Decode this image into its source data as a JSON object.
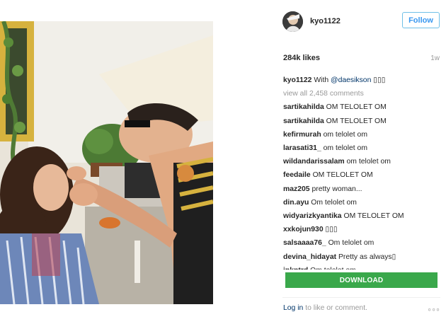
{
  "post": {
    "username": "kyo1122",
    "follow_label": "Follow",
    "likes": "284k likes",
    "time": "1w"
  },
  "caption": {
    "username": "kyo1122",
    "text_before": "With",
    "mention": "@daesikson",
    "text_after": "▯▯▯"
  },
  "view_all": "view all 2,458 comments",
  "comments": [
    {
      "user": "sartikahilda",
      "text": "OM TELOLET OM"
    },
    {
      "user": "sartikahilda",
      "text": "OM TELOLET OM"
    },
    {
      "user": "kefirmurah",
      "text": "om telolet om"
    },
    {
      "user": "larasati31_",
      "text": "om telolet om"
    },
    {
      "user": "wildandarissalam",
      "text": "om telolet om"
    },
    {
      "user": "feedaile",
      "text": "OM TELOLET OM"
    },
    {
      "user": "maz205",
      "text": "pretty woman..."
    },
    {
      "user": "din.ayu",
      "text": "Om telolet om"
    },
    {
      "user": "widyarizkyantika",
      "text": "OM TELOLET OM"
    },
    {
      "user": "xxkojun930",
      "text": "▯▯▯"
    },
    {
      "user": "salsaaaa76_",
      "text": "Om telolet om"
    },
    {
      "user": "devina_hidayat",
      "text": "Pretty as always▯"
    },
    {
      "user": "inkntrd",
      "text": "Om telolet om"
    }
  ],
  "download_label": "DOWNLOAD",
  "footer": {
    "login": "Log in",
    "rest": "to like or comment.",
    "more_icon": "ellipsis-icon"
  },
  "colors": {
    "follow_border": "#70c0e7",
    "follow_text": "#3897f0",
    "download_bg": "#3aa84b",
    "link": "#003569",
    "muted": "#999999"
  }
}
